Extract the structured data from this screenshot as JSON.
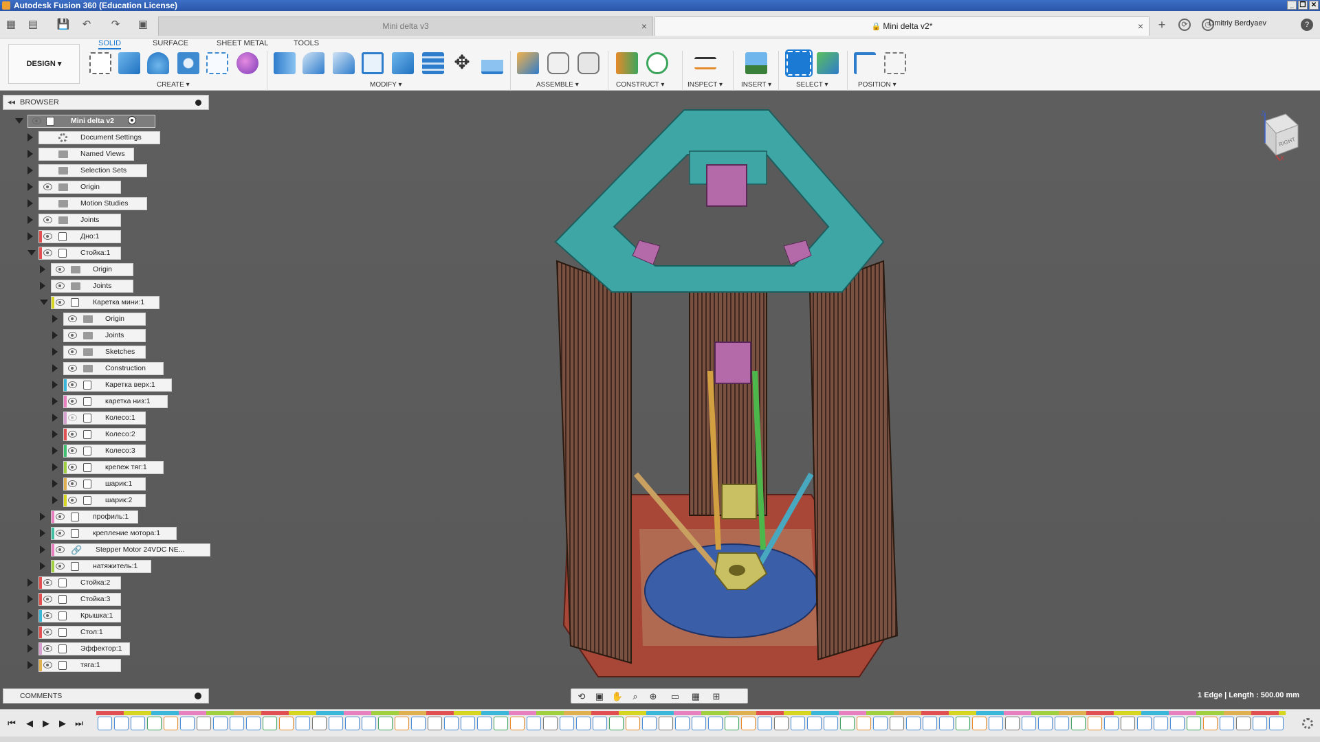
{
  "window": {
    "title": "Autodesk Fusion 360 (Education License)",
    "controls": [
      "_",
      "❐",
      "✕"
    ]
  },
  "tabs": [
    {
      "label": "Mini delta v3",
      "active": false
    },
    {
      "label": "Mini delta v2*",
      "active": true
    }
  ],
  "user": {
    "name": "Dmitriy Berdyaev"
  },
  "ribbon": {
    "workspace": "DESIGN",
    "tabs": [
      "SOLID",
      "SURFACE",
      "SHEET METAL",
      "TOOLS"
    ],
    "groups": [
      "CREATE",
      "MODIFY",
      "ASSEMBLE",
      "CONSTRUCT",
      "INSPECT",
      "INSERT",
      "SELECT",
      "POSITION"
    ]
  },
  "browser": {
    "title": "BROWSER",
    "root": "Mini delta v2",
    "items": [
      {
        "label": "Document Settings",
        "type": "settings",
        "eye": false,
        "indent": 0,
        "open": false,
        "color": ""
      },
      {
        "label": "Named Views",
        "type": "folder",
        "eye": false,
        "indent": 0,
        "open": false,
        "color": ""
      },
      {
        "label": "Selection Sets",
        "type": "folder",
        "eye": false,
        "indent": 0,
        "open": false,
        "color": ""
      },
      {
        "label": "Origin",
        "type": "folder",
        "eye": true,
        "indent": 0,
        "open": false,
        "color": ""
      },
      {
        "label": "Motion Studies",
        "type": "folder",
        "eye": false,
        "indent": 0,
        "open": false,
        "color": ""
      },
      {
        "label": "Joints",
        "type": "folder",
        "eye": true,
        "indent": 0,
        "open": false,
        "color": ""
      },
      {
        "label": "Дно:1",
        "type": "comp",
        "eye": true,
        "indent": 0,
        "open": false,
        "color": "#e05050"
      },
      {
        "label": "Стойка:1",
        "type": "comp",
        "eye": true,
        "indent": 0,
        "open": true,
        "color": "#e05050"
      },
      {
        "label": "Origin",
        "type": "folder",
        "eye": true,
        "indent": 1,
        "open": false,
        "color": ""
      },
      {
        "label": "Joints",
        "type": "folder",
        "eye": true,
        "indent": 1,
        "open": false,
        "color": ""
      },
      {
        "label": "Каретка мини:1",
        "type": "comp",
        "eye": true,
        "indent": 1,
        "open": true,
        "color": "#d6d620"
      },
      {
        "label": "Origin",
        "type": "folder",
        "eye": true,
        "indent": 2,
        "open": false,
        "color": ""
      },
      {
        "label": "Joints",
        "type": "folder",
        "eye": true,
        "indent": 2,
        "open": false,
        "color": ""
      },
      {
        "label": "Sketches",
        "type": "folder",
        "eye": true,
        "indent": 2,
        "open": false,
        "color": ""
      },
      {
        "label": "Construction",
        "type": "folder",
        "eye": true,
        "indent": 2,
        "open": false,
        "color": ""
      },
      {
        "label": "Каретка верх:1",
        "type": "comp",
        "eye": true,
        "indent": 2,
        "open": false,
        "color": "#3ab7d8"
      },
      {
        "label": "каретка низ:1",
        "type": "comp",
        "eye": true,
        "indent": 2,
        "open": false,
        "color": "#e880c0"
      },
      {
        "label": "Колесо:1",
        "type": "comp",
        "eye": false,
        "indent": 2,
        "open": false,
        "color": "#d6a0d0"
      },
      {
        "label": "Колесо:2",
        "type": "comp",
        "eye": true,
        "indent": 2,
        "open": false,
        "color": "#e05050"
      },
      {
        "label": "Колесо:3",
        "type": "comp",
        "eye": true,
        "indent": 2,
        "open": false,
        "color": "#40c070"
      },
      {
        "label": "крепеж тяг:1",
        "type": "comp",
        "eye": true,
        "indent": 2,
        "open": false,
        "color": "#a0d040"
      },
      {
        "label": "шарик:1",
        "type": "comp",
        "eye": true,
        "indent": 2,
        "open": false,
        "color": "#e0b050"
      },
      {
        "label": "шарик:2",
        "type": "comp",
        "eye": true,
        "indent": 2,
        "open": false,
        "color": "#d6d620"
      },
      {
        "label": "профиль:1",
        "type": "comp",
        "eye": true,
        "indent": 1,
        "open": false,
        "color": "#e880c0"
      },
      {
        "label": "крепление мотора:1",
        "type": "comp",
        "eye": true,
        "indent": 1,
        "open": false,
        "color": "#40c0a0"
      },
      {
        "label": "Stepper Motor 24VDC NE...",
        "type": "link",
        "eye": true,
        "indent": 1,
        "open": false,
        "color": "#e880c0"
      },
      {
        "label": "натяжитель:1",
        "type": "comp",
        "eye": true,
        "indent": 1,
        "open": false,
        "color": "#a0d040"
      },
      {
        "label": "Стойка:2",
        "type": "comp",
        "eye": true,
        "indent": 0,
        "open": false,
        "color": "#e05050"
      },
      {
        "label": "Стойка:3",
        "type": "comp",
        "eye": true,
        "indent": 0,
        "open": false,
        "color": "#e05050"
      },
      {
        "label": "Крышка:1",
        "type": "comp",
        "eye": true,
        "indent": 0,
        "open": false,
        "color": "#3ab7d8"
      },
      {
        "label": "Стол:1",
        "type": "comp",
        "eye": true,
        "indent": 0,
        "open": false,
        "color": "#e05050"
      },
      {
        "label": "Эффектор:1",
        "type": "comp",
        "eye": true,
        "indent": 0,
        "open": false,
        "color": "#d6a0d0"
      },
      {
        "label": "тяга:1",
        "type": "comp",
        "eye": true,
        "indent": 0,
        "open": false,
        "color": "#e0b050"
      }
    ]
  },
  "comments": {
    "title": "COMMENTS"
  },
  "status": {
    "text": "1 Edge | Length : 500.00 mm"
  },
  "viewcube": {
    "face": "RIGHT",
    "axis_z": "Z",
    "axis_x": "X"
  },
  "colors": {
    "accent": "#1a7ad4",
    "topPlate": "#3fa6a6",
    "columns": "#7a5040",
    "bed": "#3a5ea8",
    "base": "#a84638",
    "motor": "#b46aa8"
  }
}
